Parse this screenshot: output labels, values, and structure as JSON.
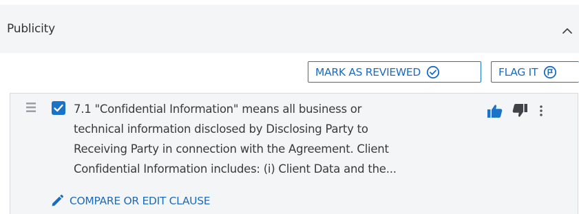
{
  "section": {
    "title": "Publicity"
  },
  "actions": {
    "mark_reviewed_label": "MARK AS REVIEWED",
    "flag_label": "FLAG IT"
  },
  "clause": {
    "checked": true,
    "text_lines": [
      "7.1 \"Confidential Information\" means all business or",
      "technical information disclosed by Disclosing Party to",
      "Receiving Party in connection with the Agreement. Client",
      "Confidential Information includes: (i) Client Data and the..."
    ],
    "compare_label": "COMPARE OR EDIT CLAUSE"
  },
  "icons": {
    "collapse": "chevron-up-icon",
    "reviewed": "check-circle-icon",
    "flag": "flag-circle-icon",
    "drag": "drag-handle-icon",
    "thumb_up": "thumbs-up-icon",
    "thumb_down": "thumbs-down-icon",
    "more": "more-vertical-icon",
    "edit": "pencil-icon"
  },
  "colors": {
    "accent": "#1a73c9",
    "header_bg": "#f3f5f7",
    "card_bg": "#f4f5f7",
    "text": "#3a3a3a",
    "icon_dark": "#3f4347"
  }
}
